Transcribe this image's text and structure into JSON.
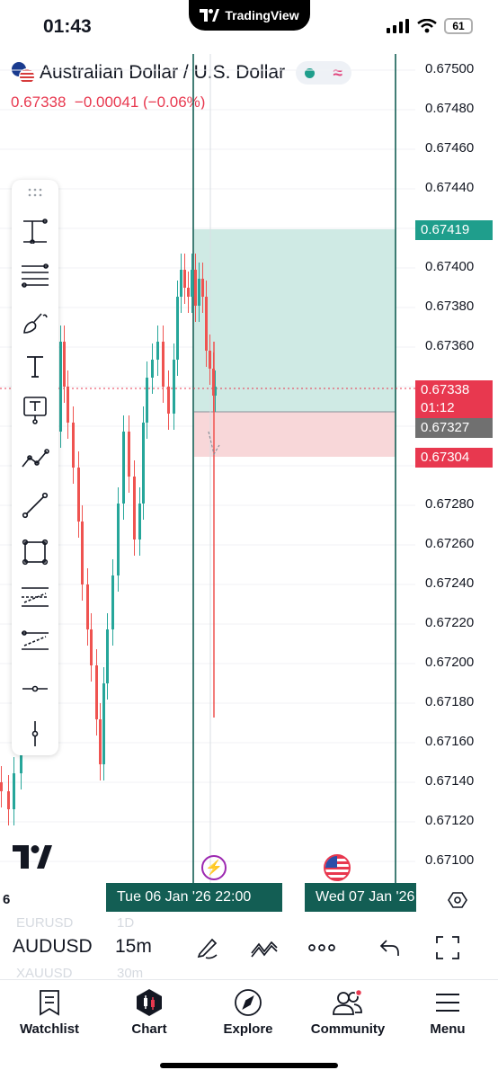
{
  "status_bar": {
    "time": "01:43",
    "island_brand": "TradingView",
    "battery": "61"
  },
  "header": {
    "title": "Australian Dollar / U.S. Dollar",
    "price": "0.67338",
    "change": "−0.00041 (−0.06%)"
  },
  "chart": {
    "price_axis": [
      "0.67500",
      "0.67480",
      "0.67460",
      "0.67440",
      "0.67400",
      "0.67380",
      "0.67360",
      "0.67280",
      "0.67260",
      "0.67240",
      "0.67220",
      "0.67200",
      "0.67180",
      "0.67160",
      "0.67140",
      "0.67120",
      "0.67100"
    ],
    "tags": {
      "target": "0.67419",
      "last": "0.67338",
      "countdown": "01:12",
      "entry": "0.67327",
      "stop": "0.67304"
    },
    "colors": {
      "up": "#26a69a",
      "down": "#ef5350",
      "profit_zone": "#cfeae4",
      "loss_zone": "#f8d7d9",
      "line": "#135e54"
    }
  },
  "time_axis": {
    "left_partial": "6",
    "label_1": "Tue 06 Jan '26   22:00",
    "label_2": "Wed 07 Jan '26"
  },
  "symbol_row": {
    "symbol": "AUDUSD",
    "interval": "15m",
    "ghost_symbol_above": "EURUSD",
    "ghost_symbol_below": "XAUUSD",
    "ghost_interval_above": "1D",
    "ghost_interval_below": "30m"
  },
  "nav": [
    {
      "label": "Watchlist",
      "icon": "watchlist-icon"
    },
    {
      "label": "Chart",
      "icon": "chart-icon"
    },
    {
      "label": "Explore",
      "icon": "compass-icon"
    },
    {
      "label": "Community",
      "icon": "community-icon"
    },
    {
      "label": "Menu",
      "icon": "menu-icon"
    }
  ]
}
